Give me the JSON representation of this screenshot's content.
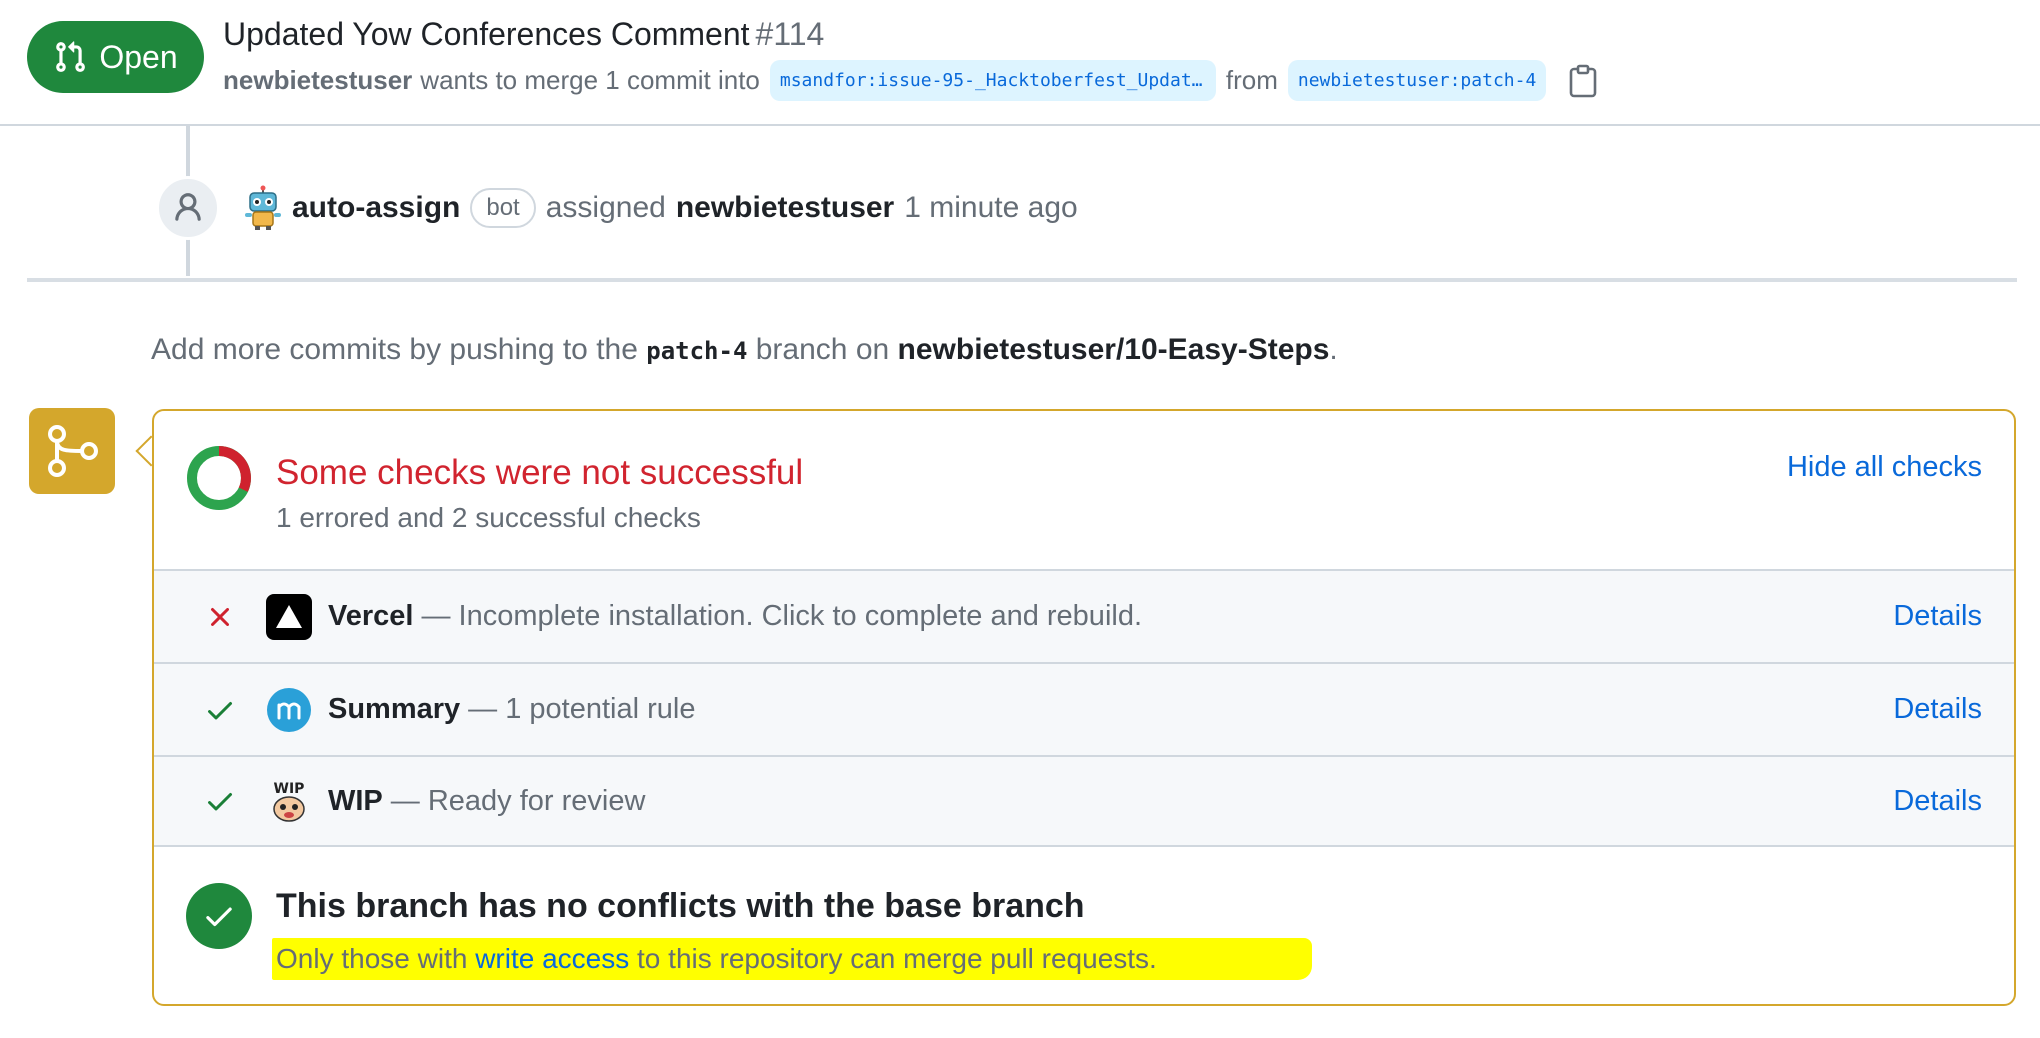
{
  "header": {
    "state": "Open",
    "title": "Updated Yow Conferences Comment",
    "number": "#114",
    "author": "newbietestuser",
    "merge_text": "wants to merge 1 commit into",
    "base_branch": "msandfor:issue-95-_Hacktoberfest_Updat…",
    "from_text": "from",
    "head_branch": "newbietestuser:patch-4"
  },
  "event": {
    "actor": "auto-assign",
    "bot_label": "bot",
    "action": "assigned",
    "assignee": "newbietestuser",
    "time": "1 minute ago"
  },
  "push_hint": {
    "prefix": "Add more commits by pushing to the",
    "branch": "patch-4",
    "middle": "branch on",
    "repo": "newbietestuser/10-Easy-Steps",
    "suffix": "."
  },
  "checks": {
    "title": "Some checks were not successful",
    "subtitle": "1 errored and 2 successful checks",
    "toggle": "Hide all checks",
    "items": [
      {
        "status": "error",
        "name": "Vercel",
        "description": "— Incomplete installation. Click to complete and rebuild.",
        "link": "Details",
        "icon": "vercel-icon"
      },
      {
        "status": "success",
        "name": "Summary",
        "description": "— 1 potential rule",
        "link": "Details",
        "icon": "mergify-icon"
      },
      {
        "status": "success",
        "name": "WIP",
        "description": "— Ready for review",
        "link": "Details",
        "icon": "wip-icon"
      }
    ]
  },
  "merge_status": {
    "title": "This branch has no conflicts with the base branch",
    "note_prefix": "Only those with",
    "note_link": "write access",
    "note_suffix": "to this repository can merge pull requests."
  },
  "colors": {
    "open_green": "#1f883d",
    "error_red": "#d1242f",
    "warning_yellow": "#d4a72c",
    "link_blue": "#0969da",
    "highlight": "#ffff00"
  }
}
